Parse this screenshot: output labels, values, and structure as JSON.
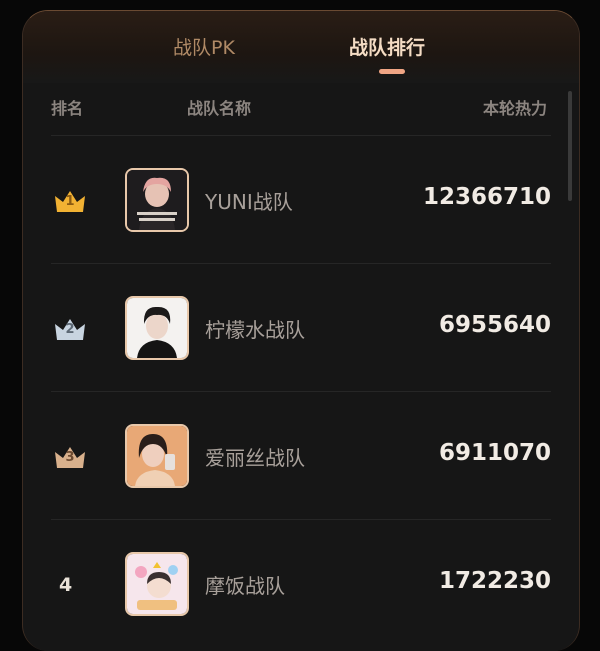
{
  "tabs": [
    {
      "label": "战队PK",
      "active": false
    },
    {
      "label": "战队排行",
      "active": true
    }
  ],
  "columns": {
    "rank": "排名",
    "name": "战队名称",
    "heat": "本轮热力"
  },
  "rows": [
    {
      "rank": "1",
      "team": "YUNI战队",
      "heat": "12366710",
      "badge": "gold-crown"
    },
    {
      "rank": "2",
      "team": "柠檬水战队",
      "heat": "6955640",
      "badge": "silver-crown"
    },
    {
      "rank": "3",
      "team": "爱丽丝战队",
      "heat": "6911070",
      "badge": "bronze-crown"
    },
    {
      "rank": "4",
      "team": "摩饭战队",
      "heat": "1722230",
      "badge": "none"
    }
  ],
  "colors": {
    "accent": "#f0a584",
    "gold": "#f2b233",
    "silver": "#c8d4e0",
    "bronze": "#d8b08c"
  }
}
